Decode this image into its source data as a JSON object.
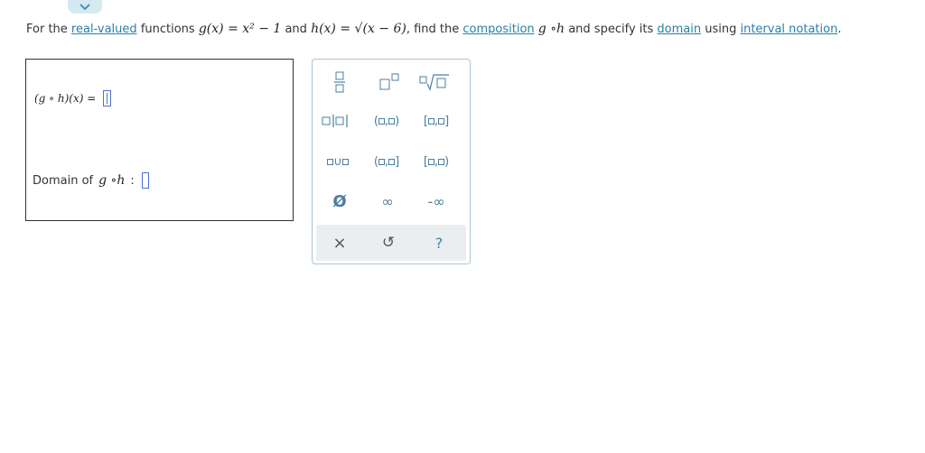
{
  "question": {
    "prefix": "For the",
    "link_real_valued": "real-valued",
    "functions_text": "functions",
    "g_def": "g(x) = x² − 1",
    "and_text": "and",
    "h_def": "h(x) = √(x − 6)",
    "find_text": ", find the",
    "link_composition": "composition",
    "composition_symbol": "g ∘h",
    "specify_text": "and specify its",
    "link_domain": "domain",
    "using_text": "using",
    "link_interval_notation": "interval notation",
    "end": "."
  },
  "answer": {
    "composition_label": "(g ∘ h)(x) =",
    "domain_label": "Domain of",
    "domain_symbol": "g ∘h",
    "domain_colon": ":"
  },
  "palette": {
    "union_symbol": "∪",
    "empty_set": "Ø",
    "infinity": "∞",
    "neg_infinity": "-∞",
    "clear_symbol": "×",
    "undo_symbol": "↺",
    "help_symbol": "?"
  },
  "colors": {
    "link": "#2a7fa8",
    "palette_icon": "#4a7fa0",
    "input_border": "#4b6fd6",
    "tab_bg": "#d6e9f2"
  }
}
